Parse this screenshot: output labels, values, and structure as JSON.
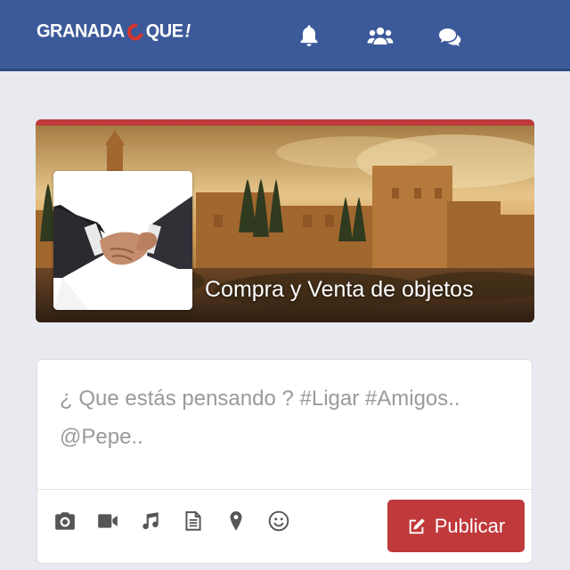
{
  "header": {
    "logo_text_left": "GRANADA",
    "logo_text_right": "QUE",
    "logo_excl": "!",
    "icons": [
      "bell-icon",
      "people-icon",
      "chat-icon"
    ]
  },
  "group": {
    "title": "Compra y Venta de objetos",
    "banner_icon": "alhambra-photo",
    "avatar_icon": "handshake-photo"
  },
  "composer": {
    "placeholder": "¿ Que estás pensando ? #Ligar #Amigos.. @Pepe..",
    "tools": [
      "camera-icon",
      "video-icon",
      "music-icon",
      "document-icon",
      "location-icon",
      "smiley-icon"
    ],
    "publish_label": "Publicar",
    "publish_icon": "edit-icon"
  },
  "colors": {
    "header_bg": "#3c5a99",
    "accent": "#c0393b",
    "page_bg": "#e9eaef"
  }
}
